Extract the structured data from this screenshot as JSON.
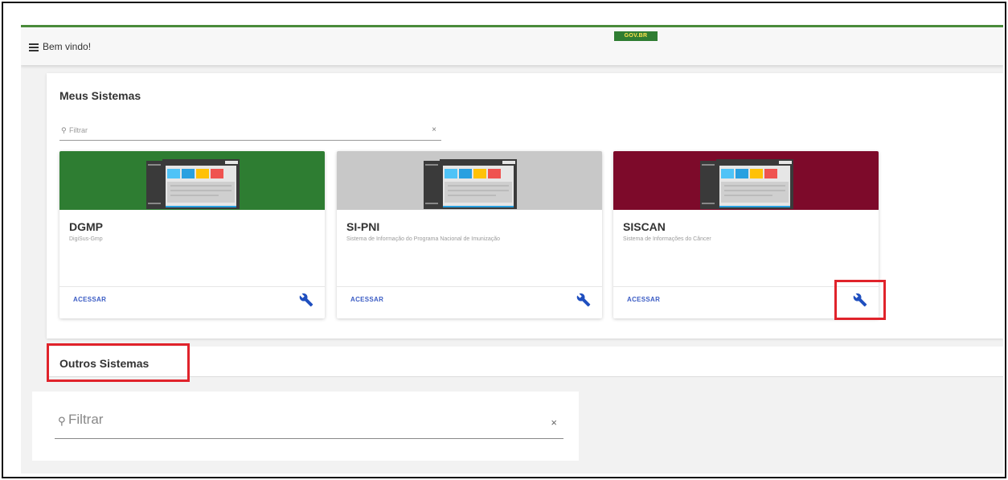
{
  "header": {
    "welcome_text": "Bem vindo!",
    "gov_logo_text": "GOV.BR",
    "accent_color": "#4a8b3a"
  },
  "meus_sistemas": {
    "title": "Meus Sistemas",
    "filter": {
      "placeholder": "Filtrar",
      "clear_label": "×",
      "search_icon": "search-icon"
    },
    "cards": [
      {
        "name": "DGMP",
        "description": "DigiSus-Gmp",
        "action_label": "ACESSAR",
        "banner_color": "#2e7d32",
        "settings_icon": "wrench-icon"
      },
      {
        "name": "SI-PNI",
        "description": "Sistema de Informação do Programa Nacional de Imunização",
        "action_label": "ACESSAR",
        "banner_color": "#c8c8c8",
        "settings_icon": "wrench-icon"
      },
      {
        "name": "SISCAN",
        "description": "Sistema de Informações do Câncer",
        "action_label": "ACESSAR",
        "banner_color": "#7d0a2a",
        "settings_icon": "wrench-icon"
      }
    ]
  },
  "outros_sistemas": {
    "title": "Outros Sistemas",
    "filter": {
      "placeholder": "Filtrar",
      "clear_label": "×",
      "search_icon": "search-icon"
    }
  },
  "colors": {
    "link": "#3b5cc4",
    "highlight": "#e0232b",
    "wrench": "#1f4fbf"
  }
}
